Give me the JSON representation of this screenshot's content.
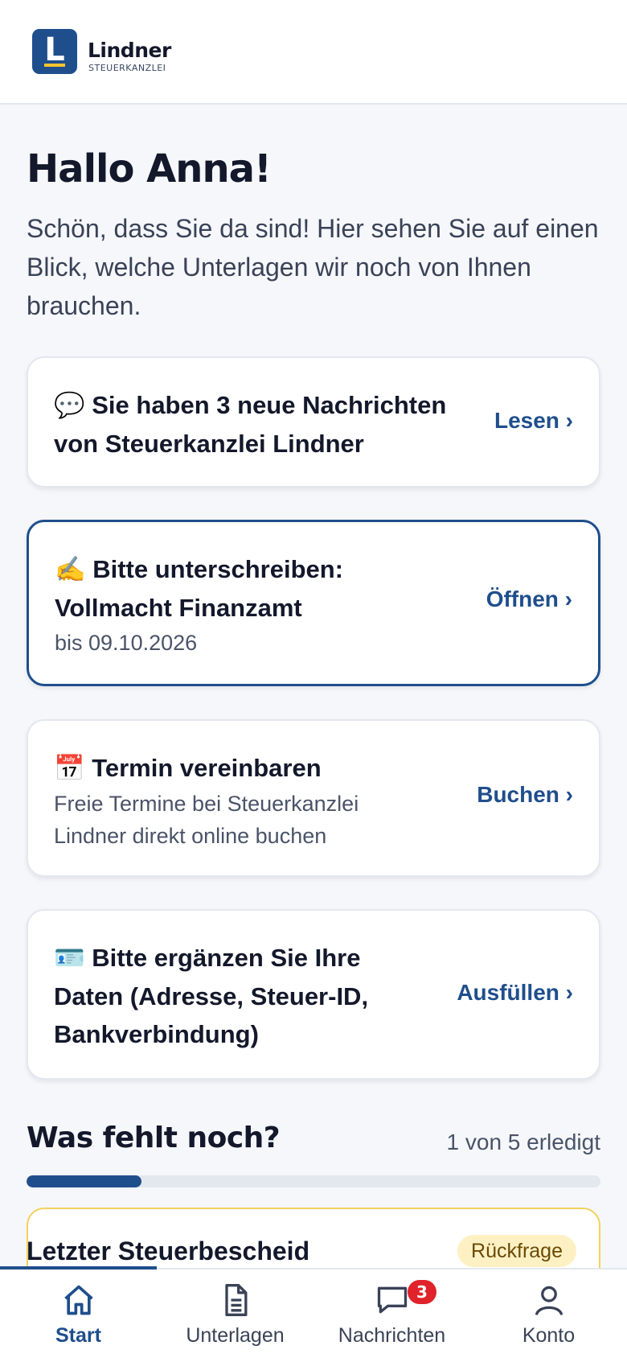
{
  "brand": {
    "logo_letter": "L",
    "name": "Lindner",
    "subtitle": "STEUERKANZLEI",
    "primary_color": "#1f4e8c",
    "accent_color": "#f4c430"
  },
  "greeting": "Hallo Anna!",
  "intro": "Schön, dass Sie da sind! Hier sehen Sie auf einen Blick, welche Unterlagen wir noch von Ihnen brauchen.",
  "cards": {
    "messages": {
      "icon": "speech-bubble-emoji",
      "emoji": "💬",
      "title": "Sie haben 3 neue Nachrichten von Steuerkanzlei Lindner",
      "action": "Lesen ›"
    },
    "sign": {
      "icon": "writing-hand-emoji",
      "emoji": "✍️",
      "title_line1": "Bitte unterschreiben:",
      "title_line2": "Vollmacht Finanzamt",
      "due": "bis 09.10.2026",
      "action": "Öffnen ›"
    },
    "appointment": {
      "icon": "calendar-emoji",
      "emoji": "📅",
      "title": "Termin vereinbaren",
      "subtitle": "Freie Termine bei Steuerkanzlei Lindner direkt online buchen",
      "action": "Buchen ›"
    },
    "data": {
      "icon": "id-card-emoji",
      "emoji": "🪪",
      "title": "Bitte ergänzen Sie Ihre Daten (Adresse, Steuer-ID, Bankverbindung)",
      "action": "Ausfüllen ›"
    }
  },
  "missing": {
    "title": "Was fehlt noch?",
    "progress_text": "1 von 5 erledigt",
    "done": 1,
    "total": 5
  },
  "documents": [
    {
      "title": "Letzter Steuerbescheid",
      "badge": "Rückfrage",
      "badge_color": "#fdf1c4"
    }
  ],
  "tabs": [
    {
      "label": "Start",
      "icon": "home-icon",
      "active": true
    },
    {
      "label": "Unterlagen",
      "icon": "document-icon",
      "active": false
    },
    {
      "label": "Nachrichten",
      "icon": "chat-icon",
      "active": false,
      "badge": "3"
    },
    {
      "label": "Konto",
      "icon": "user-icon",
      "active": false
    }
  ]
}
